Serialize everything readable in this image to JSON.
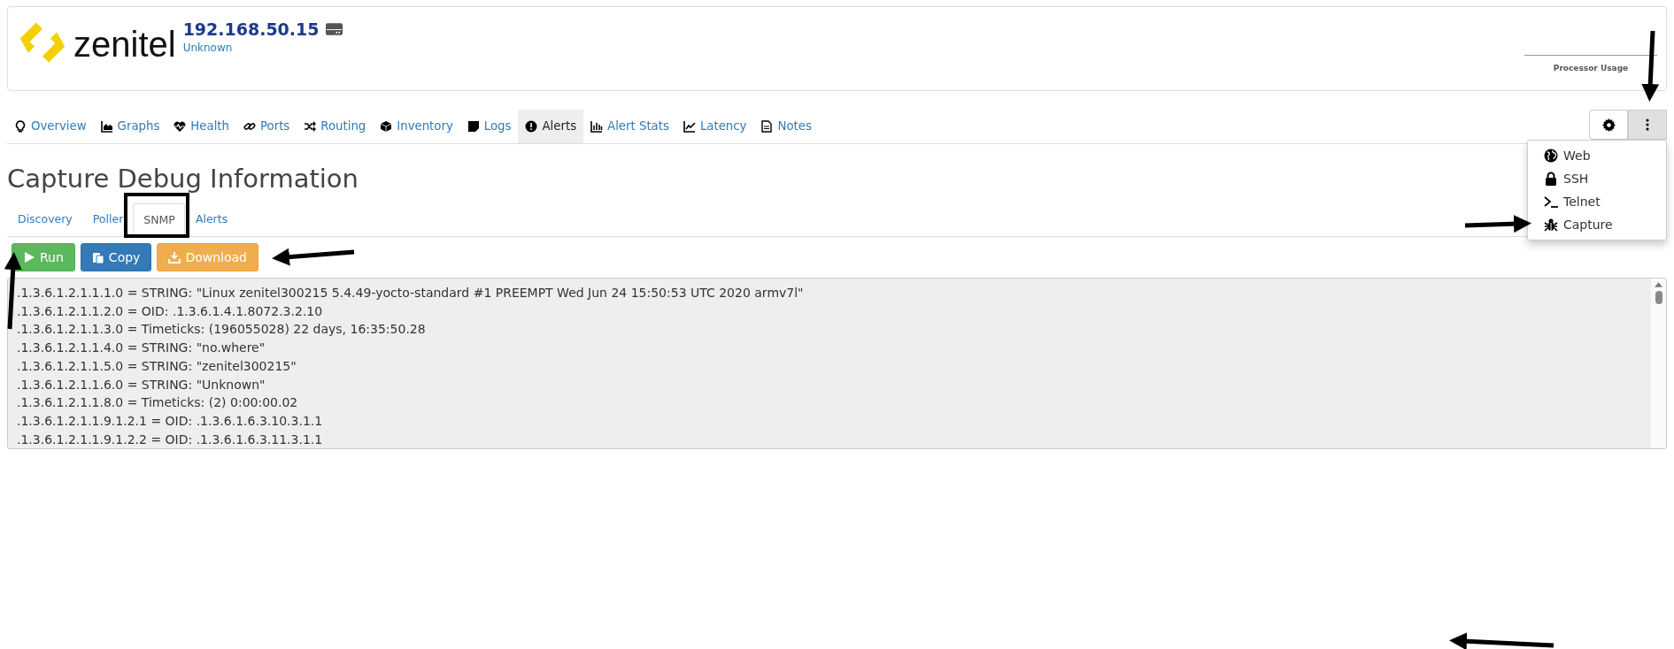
{
  "header": {
    "logo_text": "zenitel",
    "device_ip": "192.168.50.15",
    "device_subtitle": "Unknown",
    "graph_caption": "Processor Usage"
  },
  "nav_tabs": [
    {
      "label": "Overview",
      "selected": false
    },
    {
      "label": "Graphs",
      "selected": false
    },
    {
      "label": "Health",
      "selected": false
    },
    {
      "label": "Ports",
      "selected": false
    },
    {
      "label": "Routing",
      "selected": false
    },
    {
      "label": "Inventory",
      "selected": false
    },
    {
      "label": "Logs",
      "selected": false
    },
    {
      "label": "Alerts",
      "selected": true
    },
    {
      "label": "Alert Stats",
      "selected": false
    },
    {
      "label": "Latency",
      "selected": false
    },
    {
      "label": "Notes",
      "selected": false
    }
  ],
  "toolbar": {
    "menu_open": true
  },
  "menu_items": [
    {
      "label": "Web"
    },
    {
      "label": "SSH"
    },
    {
      "label": "Telnet"
    },
    {
      "label": "Capture"
    }
  ],
  "page_title": "Capture Debug Information",
  "sub_tabs": [
    {
      "label": "Discovery",
      "selected": false
    },
    {
      "label": "Poller",
      "selected": false
    },
    {
      "label": "SNMP",
      "selected": true
    },
    {
      "label": "Alerts",
      "selected": false
    }
  ],
  "actions": [
    {
      "label": "Run",
      "kind": "success"
    },
    {
      "label": "Copy",
      "kind": "primary"
    },
    {
      "label": "Download",
      "kind": "warning"
    }
  ],
  "output_lines": [
    ".1.3.6.1.2.1.1.1.0 = STRING: \"Linux zenitel300215 5.4.49-yocto-standard #1 PREEMPT Wed Jun 24 15:50:53 UTC 2020 armv7l\"",
    ".1.3.6.1.2.1.1.2.0 = OID: .1.3.6.1.4.1.8072.3.2.10",
    ".1.3.6.1.2.1.1.3.0 = Timeticks: (196055028) 22 days, 16:35:50.28",
    ".1.3.6.1.2.1.1.4.0 = STRING: \"no.where\"",
    ".1.3.6.1.2.1.1.5.0 = STRING: \"zenitel300215\"",
    ".1.3.6.1.2.1.1.6.0 = STRING: \"Unknown\"",
    ".1.3.6.1.2.1.1.8.0 = Timeticks: (2) 0:00:00.02",
    ".1.3.6.1.2.1.1.9.1.2.1 = OID: .1.3.6.1.6.3.10.3.1.1",
    ".1.3.6.1.2.1.1.9.1.2.2 = OID: .1.3.6.1.6.3.11.3.1.1"
  ]
}
